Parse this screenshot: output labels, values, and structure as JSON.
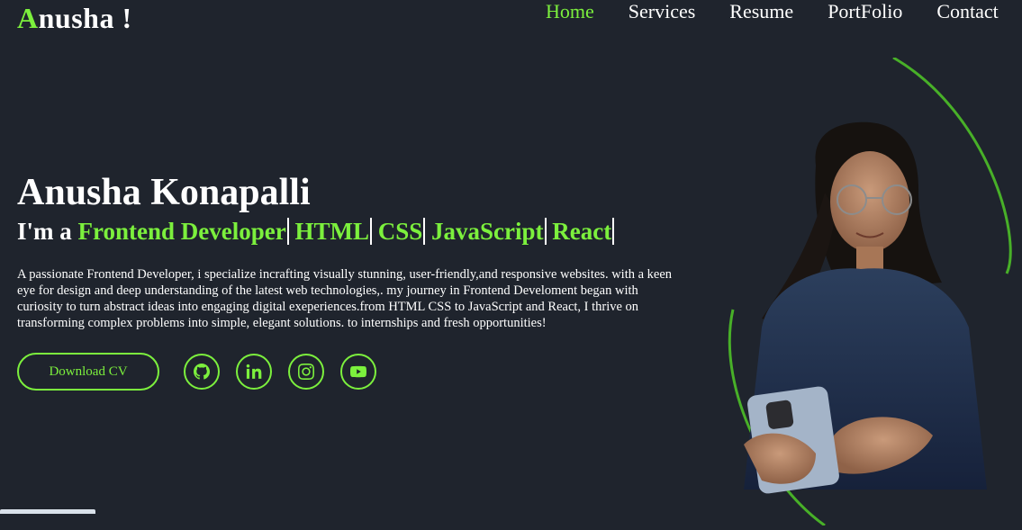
{
  "nav": {
    "logo_first": "A",
    "logo_rest": "nusha !",
    "links": [
      "Home",
      "Services",
      "Resume",
      "PortFolio",
      "Contact"
    ]
  },
  "hero": {
    "name": "Anusha Konapalli",
    "role_prefix": "I'm a",
    "roles": [
      "Frontend Developer",
      "HTML",
      "CSS",
      "JavaScript",
      "React"
    ],
    "description": "A passionate Frontend Developer, i specialize incrafting visually stunning, user-friendly,and responsive websites. with a keen eye for design and deep understanding of the latest web technologies,. my journey in Frontend Develoment began with curiosity to turn abstract ideas into engaging digital exeperiences.from HTML CSS to JavaScript and React, I thrive on transforming complex problems into simple, elegant solutions. to internships and fresh opportunities!",
    "cv_button": "Download CV",
    "socials": [
      "github-icon",
      "linkedin-icon",
      "instagram-icon",
      "youtube-icon"
    ]
  },
  "colors": {
    "background": "#1f242d",
    "accent": "#7cf03d",
    "text": "#ffffff"
  }
}
